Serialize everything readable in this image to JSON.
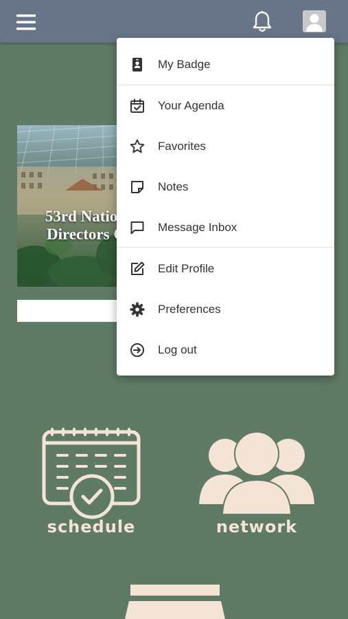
{
  "topbar": {
    "menu_icon": "hamburger-icon",
    "notification_icon": "bell-icon",
    "avatar_icon": "user-avatar-icon"
  },
  "hero": {
    "title_line1": "53rd Nation",
    "title_line2": "Directors C"
  },
  "menu": {
    "items": [
      {
        "label": "My Badge",
        "icon": "badge-icon"
      },
      {
        "label": "Your Agenda",
        "icon": "calendar-check-icon"
      },
      {
        "label": "Favorites",
        "icon": "star-icon"
      },
      {
        "label": "Notes",
        "icon": "note-icon"
      },
      {
        "label": "Message Inbox",
        "icon": "message-icon"
      },
      {
        "label": "Edit Profile",
        "icon": "edit-icon"
      },
      {
        "label": "Preferences",
        "icon": "gear-icon"
      },
      {
        "label": "Log out",
        "icon": "logout-icon"
      }
    ]
  },
  "tiles": {
    "schedule": {
      "label": "schedule",
      "icon": "calendar-icon"
    },
    "network": {
      "label": "network",
      "icon": "people-icon"
    }
  },
  "colors": {
    "topbar": "#687589",
    "background": "#5f7b65",
    "tile_icon": "#f3e4d6",
    "menu_text": "#333333"
  }
}
